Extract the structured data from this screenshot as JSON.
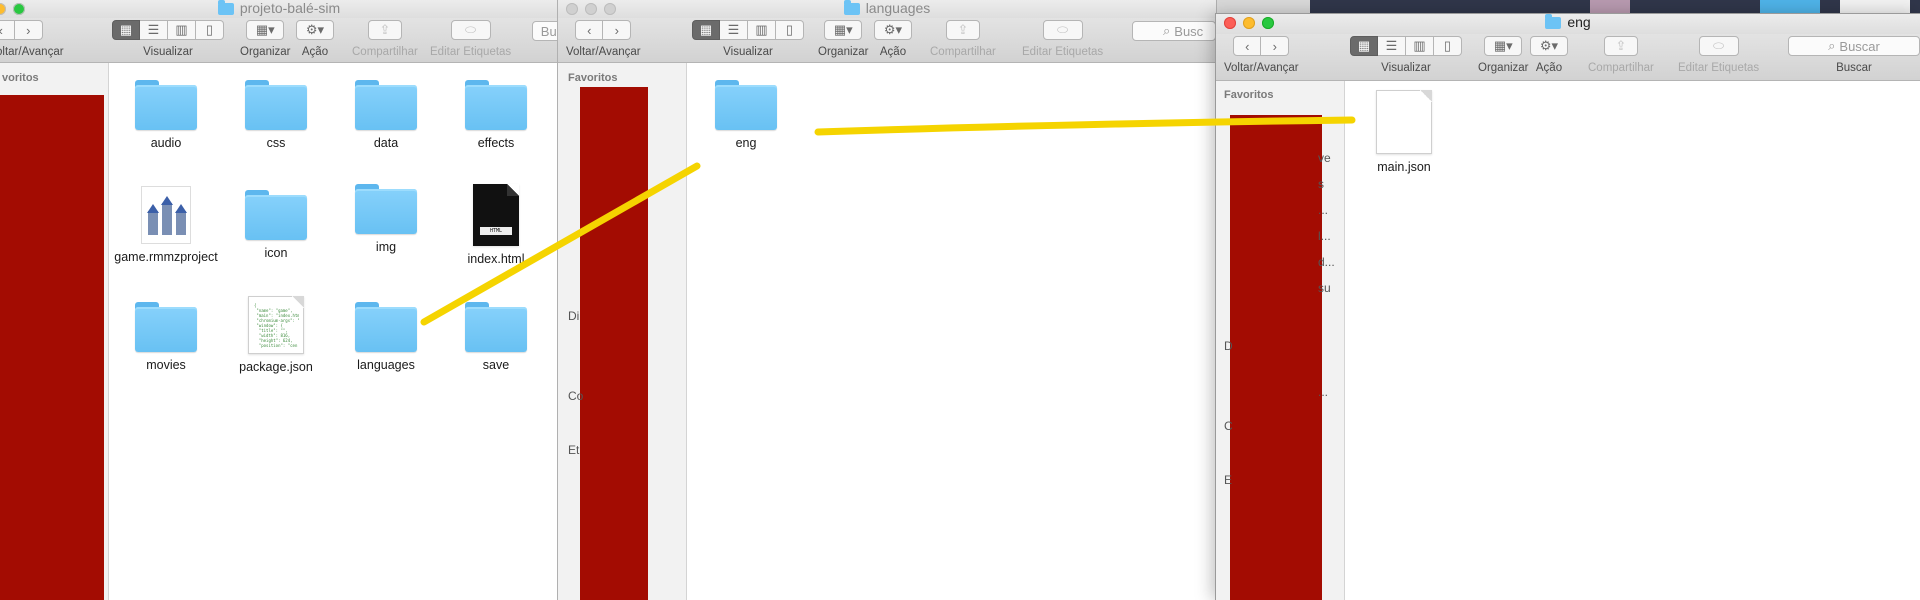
{
  "toolbar": {
    "nav": "Voltar/Avançar",
    "view": "Visualizar",
    "organize": "Organizar",
    "action": "Ação",
    "share": "Compartilhar",
    "tags": "Editar Etiquetas",
    "search_field": "Buscar",
    "search_label": "Buscar"
  },
  "window1": {
    "title": "projeto-balé-sim",
    "nav_clipped": "oltar/Avançar",
    "search_clipped": "Bus",
    "sidebar": {
      "favorites_clipped": "voritos"
    },
    "items": [
      {
        "label": "audio",
        "kind": "folder"
      },
      {
        "label": "css",
        "kind": "folder"
      },
      {
        "label": "data",
        "kind": "folder"
      },
      {
        "label": "effects",
        "kind": "folder"
      },
      {
        "label": "game.rmmzproject",
        "kind": "project-file"
      },
      {
        "label": "icon",
        "kind": "folder"
      },
      {
        "label": "img",
        "kind": "folder"
      },
      {
        "label": "index.html",
        "kind": "html-file"
      },
      {
        "label": "movies",
        "kind": "folder"
      },
      {
        "label": "package.json",
        "kind": "json-file"
      },
      {
        "label": "languages",
        "kind": "folder"
      },
      {
        "label": "save",
        "kind": "folder"
      }
    ]
  },
  "window2": {
    "title": "languages",
    "search_clipped": "Busc",
    "sidebar": {
      "favorites": "Favoritos",
      "s1": "Di",
      "s2": "Co",
      "s3": "Et"
    },
    "items": [
      {
        "label": "eng",
        "kind": "folder"
      }
    ]
  },
  "window3": {
    "title": "eng",
    "sidebar": {
      "favorites": "Favoritos",
      "frag1": "ve",
      "frag2": "s",
      "frag3": "...",
      "frag4": "l...",
      "frag5": "d...",
      "frag6": "su",
      "frag7": "D",
      "frag8": "...",
      "frag9": "C",
      "frag10": "E"
    },
    "items": [
      {
        "label": "main.json",
        "kind": "json-file"
      }
    ]
  },
  "colors": {
    "redaction": "#a30c02",
    "annotation_line": "#f5d400",
    "folder": "#75c8f8"
  }
}
